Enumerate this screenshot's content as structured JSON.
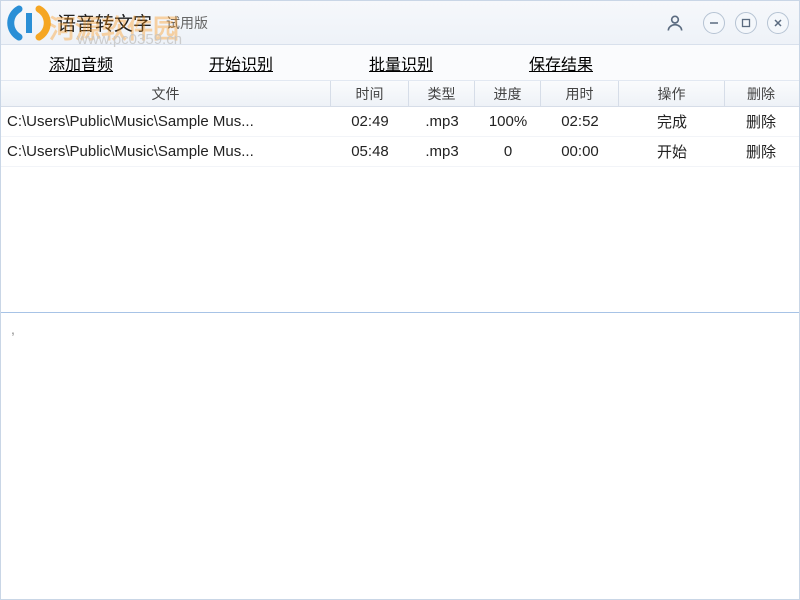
{
  "titlebar": {
    "app_title": "语音转文字",
    "edition": "试用版"
  },
  "watermark": {
    "brand": "河源软件园",
    "url": "www.pc0359.cn"
  },
  "menu": {
    "add_audio": "添加音频",
    "start_recognize": "开始识别",
    "batch_recognize": "批量识别",
    "save_result": "保存结果"
  },
  "table": {
    "headers": {
      "file": "文件",
      "time": "时间",
      "type": "类型",
      "progress": "进度",
      "elapsed": "用时",
      "operation": "操作",
      "delete": "删除"
    },
    "rows": [
      {
        "file": "C:\\Users\\Public\\Music\\Sample Mus...",
        "time": "02:49",
        "type": ".mp3",
        "progress": "100%",
        "elapsed": "02:52",
        "operation": "完成",
        "delete": "删除"
      },
      {
        "file": "C:\\Users\\Public\\Music\\Sample Mus...",
        "time": "05:48",
        "type": ".mp3",
        "progress": "0",
        "elapsed": "00:00",
        "operation": "开始",
        "delete": "删除"
      }
    ]
  },
  "bottom": {
    "content": ","
  }
}
